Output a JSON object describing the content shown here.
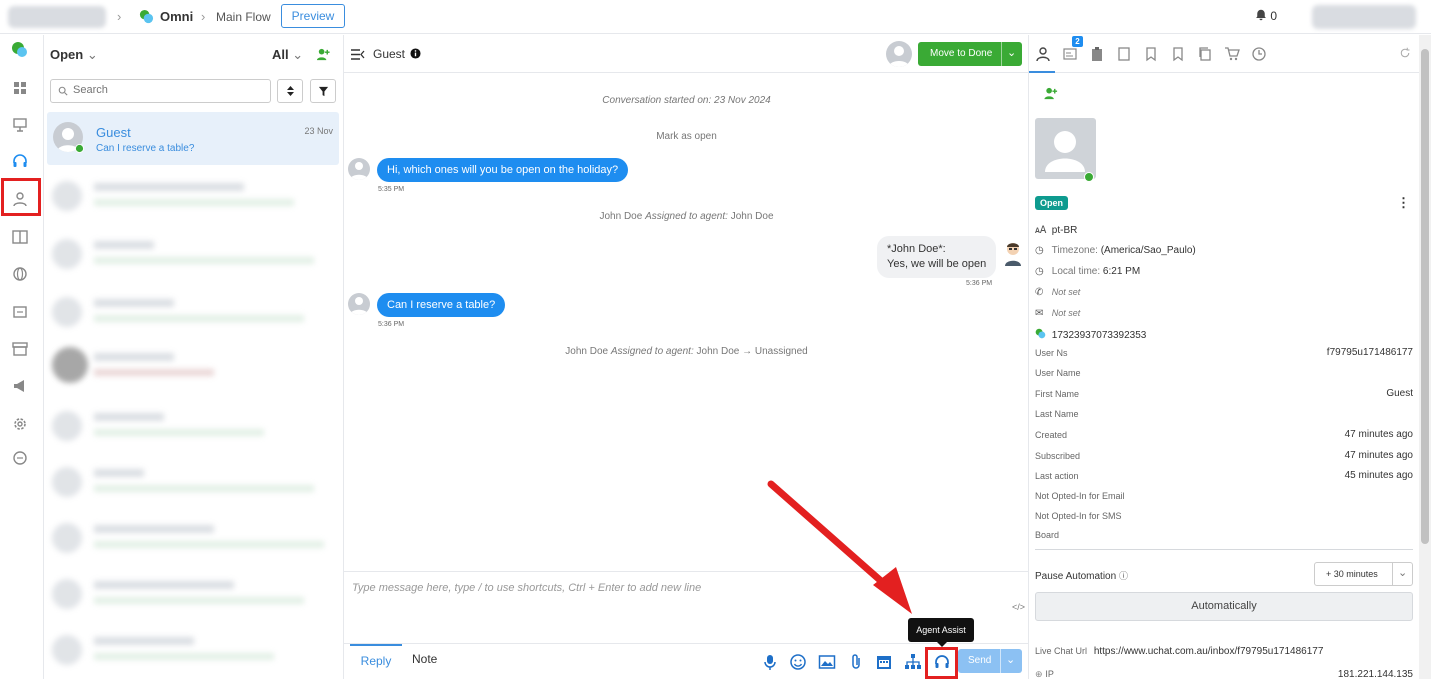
{
  "topbar": {
    "app_name": "Omni",
    "flow_name": "Main Flow",
    "preview_label": "Preview",
    "notifications_count": "0"
  },
  "conversations": {
    "status_filter": "Open",
    "assignee_filter": "All",
    "search_placeholder": "Search",
    "active": {
      "name": "Guest",
      "preview": "Can I reserve a table?",
      "date": "23 Nov"
    }
  },
  "chat": {
    "contact_name": "Guest",
    "move_to_done_label": "Move to Done",
    "started": "Conversation started on: 23 Nov 2024",
    "mark_open": "Mark as open",
    "msg1": {
      "text": "Hi, which ones will you be open on the holiday?",
      "time": "5:35 PM"
    },
    "assign1": {
      "actor": "John Doe",
      "action": "Assigned to agent:",
      "target": "John Doe"
    },
    "msg2": {
      "line1": "*John Doe*:",
      "line2": "Yes, we will be open",
      "time": "5:36 PM"
    },
    "msg3": {
      "text": "Can I reserve a table?",
      "time": "5:36 PM"
    },
    "assign2": {
      "actor": "John Doe",
      "action": "Assigned to agent:",
      "target": "John Doe → Unassigned"
    },
    "composer_placeholder": "Type message here, type / to use shortcuts, Ctrl + Enter to add new line",
    "tab_reply": "Reply",
    "tab_note": "Note",
    "send_label": "Send",
    "tooltip": "Agent Assist"
  },
  "profile": {
    "tabs_badge": "2",
    "status": "Open",
    "language": "pt-BR",
    "timezone_label": "Timezone:",
    "timezone_value": "(America/Sao_Paulo)",
    "localtime_label": "Local time:",
    "localtime_value": "6:21 PM",
    "phone": "Not set",
    "email": "Not set",
    "channel_id": "17323937073392353",
    "fields": [
      {
        "label": "User Ns",
        "value": "f79795u171486177"
      },
      {
        "label": "User Name",
        "value": ""
      },
      {
        "label": "First Name",
        "value": "Guest"
      },
      {
        "label": "Last Name",
        "value": ""
      },
      {
        "label": "Created",
        "value": "47 minutes ago"
      },
      {
        "label": "Subscribed",
        "value": "47 minutes ago"
      },
      {
        "label": "Last action",
        "value": "45 minutes ago"
      },
      {
        "label": "Not Opted-In for Email",
        "value": ""
      },
      {
        "label": "Not Opted-In for SMS",
        "value": ""
      },
      {
        "label": "Board",
        "value": ""
      }
    ],
    "pause_label": "Pause Automation",
    "pause_value": "+ 30 minutes",
    "automatically_label": "Automatically",
    "livechat_label": "Live Chat Url",
    "livechat_value": "https://www.uchat.com.au/inbox/f79795u171486177",
    "ip_label": "IP",
    "ip_value": "181.221.144.135"
  },
  "colors": {
    "accent": "#1e8df0",
    "success": "#3aaa35",
    "highlight": "#e32020"
  }
}
